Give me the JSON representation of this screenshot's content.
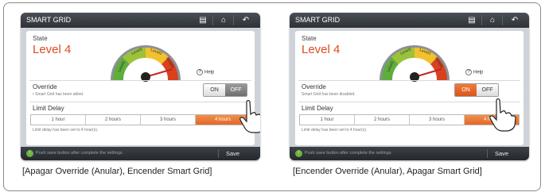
{
  "panels": [
    {
      "title": "SMART GRID",
      "state_label": "State",
      "state_value": "Level 4",
      "gauge_labels": [
        "Level1",
        "Level2",
        "Level3",
        "Level4"
      ],
      "help_label": "Help",
      "override_label": "Override",
      "override_note": "• Smart Grid has been abled.",
      "toggle": {
        "on": "ON",
        "off": "OFF",
        "active": "off"
      },
      "limit_label": "Limit Delay",
      "delay_options": [
        "1 hour",
        "2 hours",
        "3 hours",
        "4 hours"
      ],
      "delay_selected": 3,
      "limit_note": "Limit delay has been set to 4 hour(s).",
      "tip": "Push save button after complete the settings.",
      "save_label": "Save"
    },
    {
      "title": "SMART GRID",
      "state_label": "State",
      "state_value": "Level 4",
      "gauge_labels": [
        "Level1",
        "Level2",
        "Level3",
        "Level4"
      ],
      "help_label": "Help",
      "override_label": "Override",
      "override_note": "Smart Grid has been disabled.",
      "toggle": {
        "on": "ON",
        "off": "OFF",
        "active": "on"
      },
      "limit_label": "Limit Delay",
      "delay_options": [
        "1 hour",
        "2 hours",
        "3 hours",
        "4 hours"
      ],
      "delay_selected": 3,
      "limit_note": "Limit delay has been set to 4 hour(s).",
      "tip": "Push save button after complete the settings.",
      "save_label": "Save"
    }
  ],
  "captions": [
    "[Apagar Override (Anular), Encender Smart Grid]",
    "[Encender Override (Anular), Apagar Smart Grid]"
  ],
  "colors": {
    "accent": "#e5672a",
    "level_text": "#e04a1f",
    "titlebar": "#2e3238",
    "gauge_green": "#5fae3b",
    "gauge_yellow": "#f2c12e",
    "gauge_red": "#d9401c"
  },
  "icons": [
    "memo-icon",
    "home-icon",
    "back-icon",
    "help-icon",
    "tip-icon",
    "hand-pointer-icon"
  ]
}
